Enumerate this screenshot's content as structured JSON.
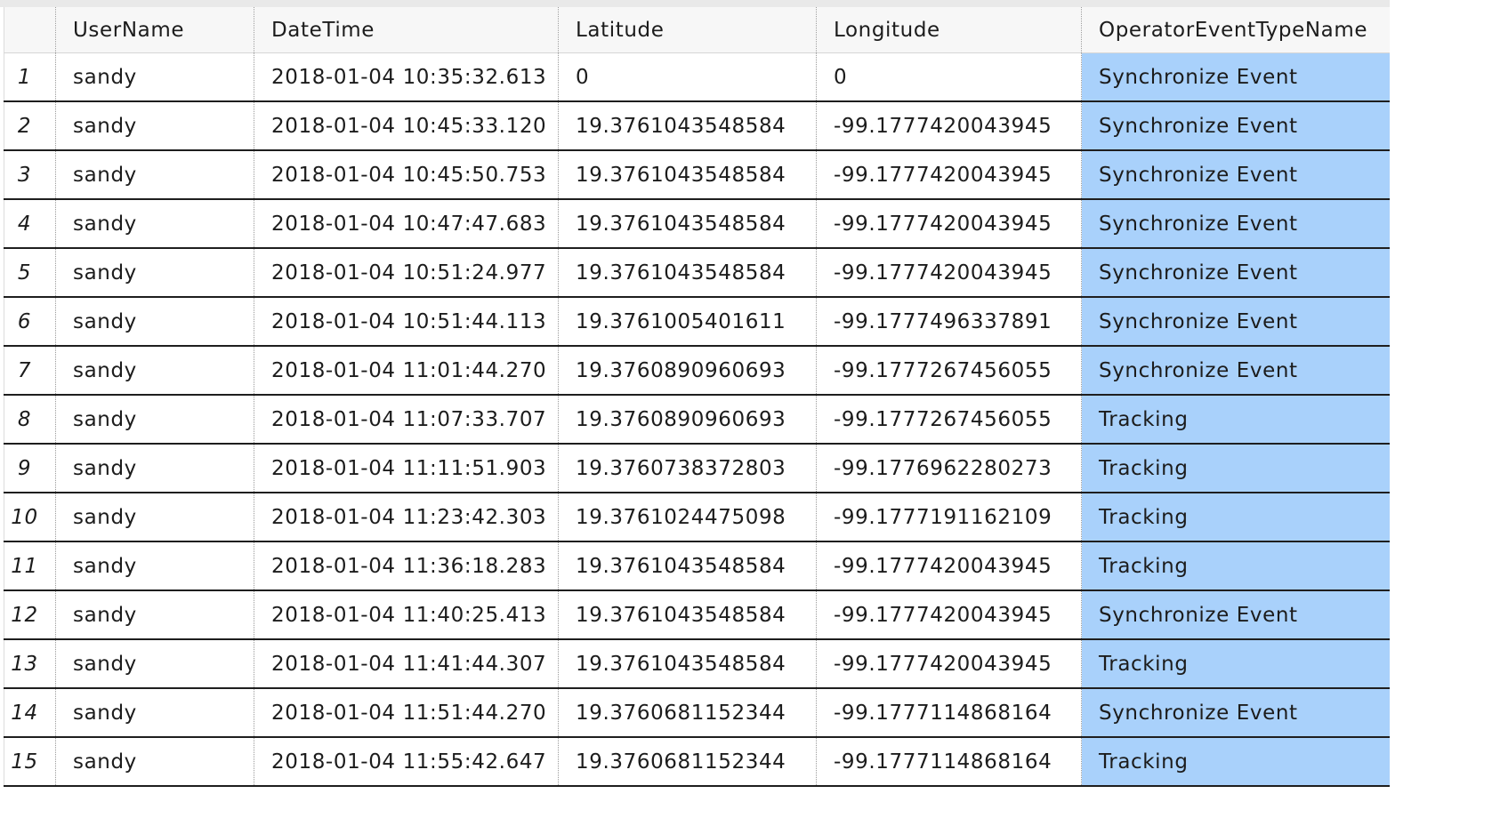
{
  "table": {
    "columns": [
      "",
      "UserName",
      "DateTime",
      "Latitude",
      "Longitude",
      "OperatorEventTypeName"
    ],
    "rows": [
      {
        "num": "1",
        "user": "sandy",
        "datetime": "2018-01-04 10:35:32.613",
        "lat": "0",
        "lon": "0",
        "event": "Synchronize Event"
      },
      {
        "num": "2",
        "user": "sandy",
        "datetime": "2018-01-04 10:45:33.120",
        "lat": "19.3761043548584",
        "lon": "-99.1777420043945",
        "event": "Synchronize Event"
      },
      {
        "num": "3",
        "user": "sandy",
        "datetime": "2018-01-04 10:45:50.753",
        "lat": "19.3761043548584",
        "lon": "-99.1777420043945",
        "event": "Synchronize Event"
      },
      {
        "num": "4",
        "user": "sandy",
        "datetime": "2018-01-04 10:47:47.683",
        "lat": "19.3761043548584",
        "lon": "-99.1777420043945",
        "event": "Synchronize Event"
      },
      {
        "num": "5",
        "user": "sandy",
        "datetime": "2018-01-04 10:51:24.977",
        "lat": "19.3761043548584",
        "lon": "-99.1777420043945",
        "event": "Synchronize Event"
      },
      {
        "num": "6",
        "user": "sandy",
        "datetime": "2018-01-04 10:51:44.113",
        "lat": "19.3761005401611",
        "lon": "-99.1777496337891",
        "event": "Synchronize Event"
      },
      {
        "num": "7",
        "user": "sandy",
        "datetime": "2018-01-04 11:01:44.270",
        "lat": "19.3760890960693",
        "lon": "-99.1777267456055",
        "event": "Synchronize Event"
      },
      {
        "num": "8",
        "user": "sandy",
        "datetime": "2018-01-04 11:07:33.707",
        "lat": "19.3760890960693",
        "lon": "-99.1777267456055",
        "event": "Tracking"
      },
      {
        "num": "9",
        "user": "sandy",
        "datetime": "2018-01-04 11:11:51.903",
        "lat": "19.3760738372803",
        "lon": "-99.1776962280273",
        "event": "Tracking"
      },
      {
        "num": "10",
        "user": "sandy",
        "datetime": "2018-01-04 11:23:42.303",
        "lat": "19.3761024475098",
        "lon": "-99.1777191162109",
        "event": "Tracking"
      },
      {
        "num": "11",
        "user": "sandy",
        "datetime": "2018-01-04 11:36:18.283",
        "lat": "19.3761043548584",
        "lon": "-99.1777420043945",
        "event": "Tracking"
      },
      {
        "num": "12",
        "user": "sandy",
        "datetime": "2018-01-04 11:40:25.413",
        "lat": "19.3761043548584",
        "lon": "-99.1777420043945",
        "event": "Synchronize Event"
      },
      {
        "num": "13",
        "user": "sandy",
        "datetime": "2018-01-04 11:41:44.307",
        "lat": "19.3761043548584",
        "lon": "-99.1777420043945",
        "event": "Tracking"
      },
      {
        "num": "14",
        "user": "sandy",
        "datetime": "2018-01-04 11:51:44.270",
        "lat": "19.3760681152344",
        "lon": "-99.1777114868164",
        "event": "Synchronize Event"
      },
      {
        "num": "15",
        "user": "sandy",
        "datetime": "2018-01-04 11:55:42.647",
        "lat": "19.3760681152344",
        "lon": "-99.1777114868164",
        "event": "Tracking"
      }
    ]
  },
  "colors": {
    "selected_column": "#a9d1fb",
    "header_background": "#f7f7f7",
    "row_separator": "#1e1e1e"
  }
}
